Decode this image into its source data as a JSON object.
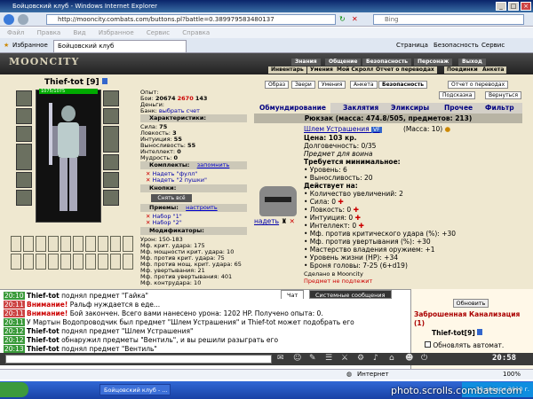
{
  "window": {
    "title": "Бойцовский клуб - Windows Internet Explorer"
  },
  "address": {
    "url": "http://mooncity.combats.com/buttons.pl?battle=0.389979583480137",
    "search_placeholder": "Bing"
  },
  "menubar": [
    "Файл",
    "Правка",
    "Вид",
    "Избранное",
    "Сервис",
    "Справка"
  ],
  "tabs": {
    "favorites": "Избранное",
    "current": "Бойцовский клуб",
    "tools": [
      "Страница",
      "Безопасность",
      "Сервис"
    ]
  },
  "game": {
    "logo": "MOONCITY",
    "nav_top": [
      "Знания",
      "Общение",
      "Безопасность",
      "Персонаж",
      "Выход"
    ],
    "nav_bottom": [
      "Инвентарь",
      "Умения",
      "Мой Скролл",
      "Отчет о переводах",
      "Поединки",
      "Анкета"
    ]
  },
  "character": {
    "name": "Thief-tot",
    "level": "[9]",
    "hp": "1075/1075",
    "opyt_label": "Опыт:",
    "opyt": "",
    "boy_label": "Бои:",
    "boy": "20674",
    "boy_extra": "2670",
    "boy_extra2": "143",
    "money_label": "Деньги:",
    "bank_label": "Банк:",
    "bank_link": "выбрать счет",
    "characteristics_header": "Характеристики:",
    "stats": [
      {
        "label": "Сила:",
        "value": "75"
      },
      {
        "label": "Ловкость:",
        "value": "3"
      },
      {
        "label": "Интуиция:",
        "value": "55"
      },
      {
        "label": "Выносливость:",
        "value": "55"
      },
      {
        "label": "Интеллект:",
        "value": "0"
      },
      {
        "label": "Мудрость:",
        "value": "0"
      }
    ],
    "sets_header": "Комплекты:",
    "sets_link": "запомнить",
    "sets": [
      "Надеть \"фулл\"",
      "Надеть \"2 пушки\""
    ],
    "buttons_header": "Кнопки:",
    "remove_all": "Снять всё",
    "priemy_header": "Приемы:",
    "priemy_link": "настроить",
    "priemy": [
      "Набор \"1\"",
      "Набор \"2\""
    ],
    "modifiers_header": "Модификаторы:",
    "modifiers": [
      "Урон: 150-183",
      "Мф. крит. удара: 175",
      "Мф. мощности крит. удара: 10",
      "Мф. против крит. удара: 75",
      "Мф. против мощ. крит. удара: 65",
      "Мф. увертывания: 21",
      "Мф. против увертывания: 401",
      "Мф. контрудара: 10"
    ]
  },
  "right": {
    "buttons": [
      "Образ",
      "Звери",
      "Умения",
      "Анкета",
      "Безопасность",
      "Отчет о переводах"
    ],
    "hint": "Подсказка",
    "back": "Вернуться",
    "tabs": [
      "Обмундирование",
      "Заклятия",
      "Эликсиры",
      "Прочее",
      "Фильтр"
    ],
    "backpack": "Рюкзак (масса: 474.8/505, предметов: 213)",
    "item": {
      "name": "Шлем Устрашения",
      "badge": "VF",
      "mass": "(Масса: 10)",
      "price": "Цена: 103 кр.",
      "durability": "Долговечность: 0/35",
      "for_class": "Предмет для воина",
      "req_header": "Требуется минимальное:",
      "requirements": [
        "• Уровень: 6",
        "• Выносливость: 20"
      ],
      "acts_header": "Действует на:",
      "effects": [
        "• Количество увеличений: 2",
        "• Сила: 0",
        "• Ловкость: 0",
        "• Интуиция: 0",
        "• Интеллект: 0",
        "• Мф. против критического удара (%): +30",
        "• Мф. против увертывания (%): +30",
        "• Мастерство владения оружием: +1",
        "• Уровень жизни (HP): +34",
        "• Броня головы: 7-25 (6+d19)"
      ],
      "made": "Сделано в Mooncity",
      "extra": "Предмет не подлежит",
      "wear": "надеть"
    }
  },
  "chat": {
    "tabs": [
      "Чат",
      "Системные сообщения"
    ],
    "lines": [
      {
        "time": "20:10",
        "red": false,
        "who": "Thief-tot",
        "text": " поднял предмет \"Гайка\""
      },
      {
        "time": "20:11",
        "red": true,
        "who": "",
        "warn": "Внимание!",
        "text": " Ральф нуждается в еде..."
      },
      {
        "time": "20:11",
        "red": true,
        "who": "",
        "warn": "Внимание!",
        "text": " Бой закончен. Всего вами нанесено урона: 1202 HP. Получено опыта: 0."
      },
      {
        "time": "20:11",
        "red": false,
        "who": "",
        "text": "У Мартын Водопроводчик был предмет \"Шлем Устрашения\" и Thief-tot может подобрать его"
      },
      {
        "time": "20:12",
        "red": false,
        "who": "Thief-tot",
        "text": " поднял предмет \"Шлем Устрашения\""
      },
      {
        "time": "20:12",
        "red": false,
        "who": "Thief-tot",
        "text": " обнаружил предметы \"Вентиль\", и вы решили разыграть его"
      },
      {
        "time": "20:13",
        "red": false,
        "who": "Thief-tot",
        "text": " поднял предмет \"Вентиль\""
      }
    ]
  },
  "location": {
    "refresh": "Обновить",
    "name": "Заброшенная Канализация",
    "count": "(1)",
    "user": "Thief-tot[9]",
    "auto": "Обновлять автомат."
  },
  "clock": "20:58",
  "status": {
    "zone": "Интернет",
    "zoom": "100%"
  },
  "taskbar": {
    "task": "Бойцовский клуб - ...",
    "date": "30 января 2010 г."
  },
  "watermark": "photo.scrolls.combats.com",
  "colors": {
    "accent": "#0000aa",
    "warning": "#cc0000",
    "header": "#222222"
  }
}
